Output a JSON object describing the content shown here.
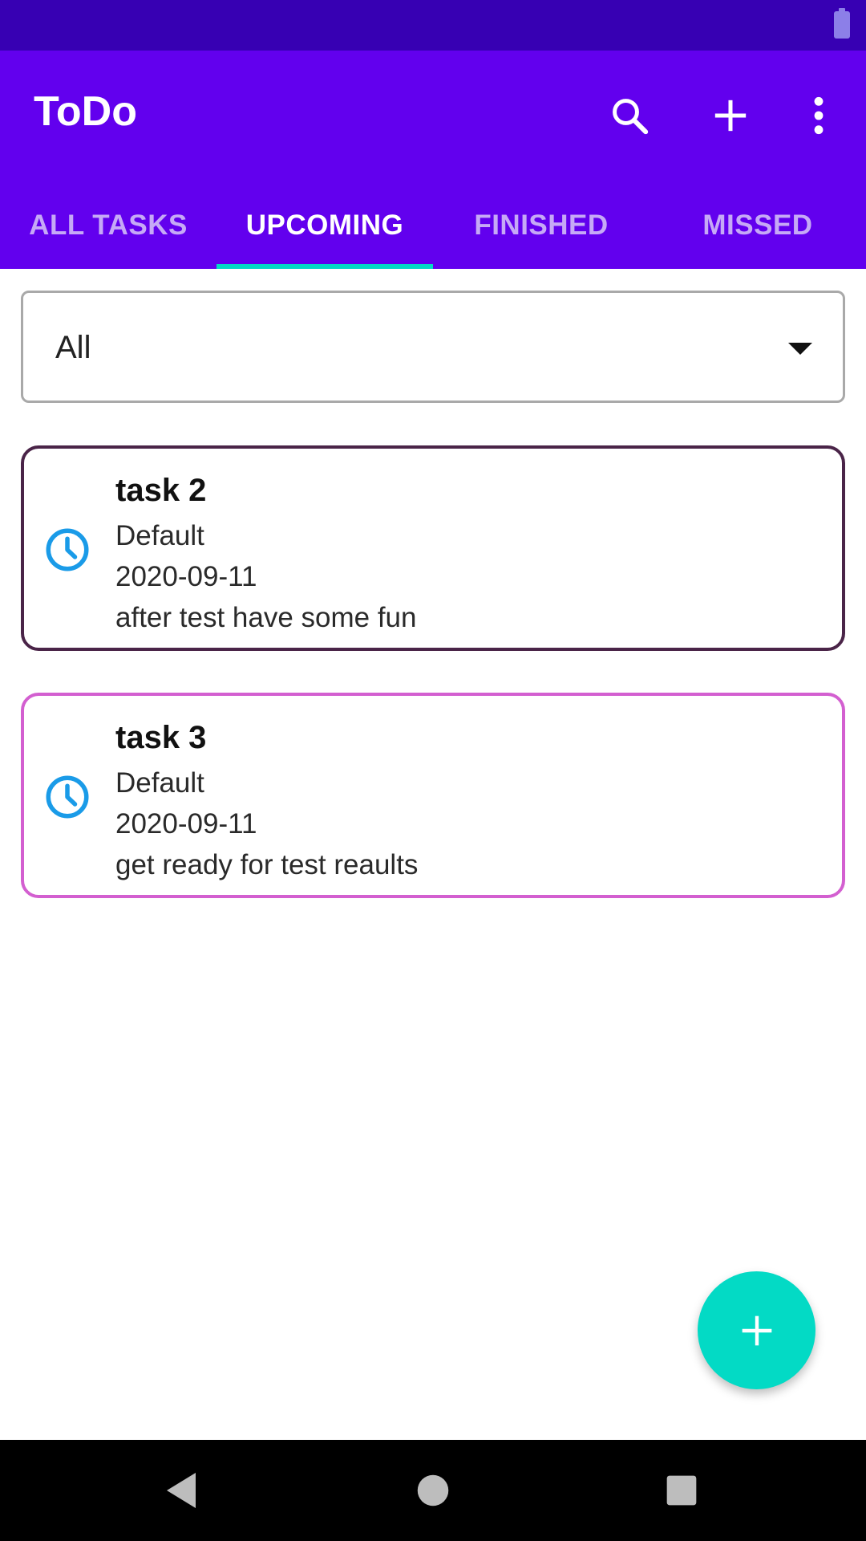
{
  "app": {
    "title": "ToDo"
  },
  "toolbar": {
    "actions": [
      {
        "name": "search",
        "icon": "search-icon"
      },
      {
        "name": "add",
        "icon": "plus-icon"
      },
      {
        "name": "more",
        "icon": "more-vert-icon"
      }
    ]
  },
  "tabs": [
    {
      "label": "ALL TASKS",
      "active": false
    },
    {
      "label": "UPCOMING",
      "active": true
    },
    {
      "label": "FINISHED",
      "active": false
    },
    {
      "label": "MISSED",
      "active": false
    }
  ],
  "filter": {
    "selected": "All"
  },
  "tasks": [
    {
      "title": "task 2",
      "category": "Default",
      "date": "2020-09-11",
      "note": "after test have some fun",
      "border_color": "#4a2448",
      "icon": "clock-icon"
    },
    {
      "title": "task 3",
      "category": "Default",
      "date": "2020-09-11",
      "note": "get ready for test reaults",
      "border_color": "#d35fd0",
      "icon": "clock-icon"
    }
  ],
  "colors": {
    "status_bar": "#3700b3",
    "app_bar": "#6200ee",
    "accent": "#03dac5",
    "clock": "#1a9be8"
  }
}
